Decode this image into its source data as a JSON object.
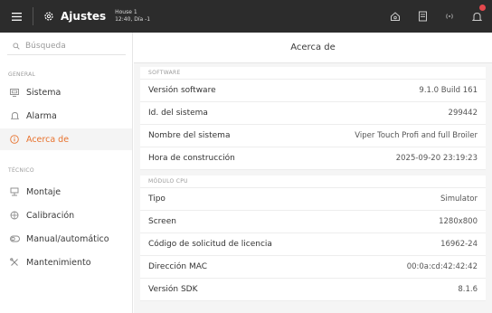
{
  "topbar": {
    "title": "Ajustes",
    "house_name": "House 1",
    "house_time": "12:40, Día -1"
  },
  "sidebar": {
    "search_placeholder": "Búsqueda",
    "general_title": "GENERAL",
    "general_items": [
      {
        "label": "Sistema",
        "icon": "monitor-icon"
      },
      {
        "label": "Alarma",
        "icon": "bell-icon"
      },
      {
        "label": "Acerca de",
        "icon": "info-icon",
        "active": true
      }
    ],
    "tecnico_title": "TÉCNICO",
    "tecnico_items": [
      {
        "label": "Montaje",
        "icon": "assembly-icon"
      },
      {
        "label": "Calibración",
        "icon": "calibration-icon"
      },
      {
        "label": "Manual/automático",
        "icon": "toggle-icon"
      },
      {
        "label": "Mantenimiento",
        "icon": "tools-icon"
      }
    ]
  },
  "main": {
    "title": "Acerca de",
    "software": {
      "title": "SOFTWARE",
      "rows": [
        {
          "k": "Versión software",
          "v": "9.1.0 Build 161"
        },
        {
          "k": "Id. del sistema",
          "v": "299442"
        },
        {
          "k": "Nombre del sistema",
          "v": "Viper Touch Profi and full Broiler"
        },
        {
          "k": "Hora de construcción",
          "v": "2025-09-20 23:19:23"
        }
      ]
    },
    "cpu": {
      "title": "MÓDULO CPU",
      "rows": [
        {
          "k": "Tipo",
          "v": "Simulator"
        },
        {
          "k": "Screen",
          "v": "1280x800"
        },
        {
          "k": "Código de solicitud de licencia",
          "v": "16962-24"
        },
        {
          "k": "Dirección MAC",
          "v": "00:0a:cd:42:42:42"
        },
        {
          "k": "Versión SDK",
          "v": "8.1.6"
        }
      ]
    }
  },
  "colors": {
    "accent": "#e8732f",
    "topbar": "#2c2c2c",
    "badge": "#e5484d"
  }
}
